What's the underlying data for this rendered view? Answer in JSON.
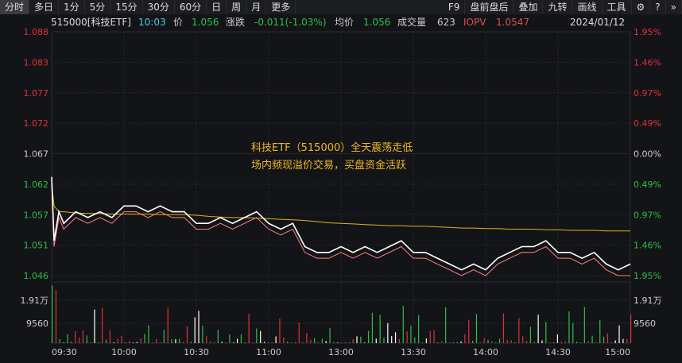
{
  "tabs": [
    "分时",
    "多日",
    "1分",
    "5分",
    "15分",
    "30分",
    "60分",
    "日",
    "周",
    "月",
    "更多"
  ],
  "right_tabs": [
    "F9",
    "盘前盘后",
    "叠加",
    "九转",
    "画线",
    "工具"
  ],
  "info": {
    "code": "515000[科技ETF]",
    "time": "10:03",
    "price_label": "价",
    "price": "1.056",
    "change_label": "涨跌",
    "change": "-0.011(-1.03%)",
    "avg_label": "均价",
    "avg": "1.056",
    "vol_label": "成交量",
    "vol": "623",
    "iopv_label": "IOPV",
    "iopv": "1.0547",
    "date": "2024/01/12"
  },
  "annotation": [
    "科技ETF（515000）全天震荡走低",
    "场内频现溢价交易，买盘资金活跃"
  ],
  "colors": {
    "up": "#e0303a",
    "down": "#2fbf4a",
    "price": "#ffffff",
    "iopv": "#ff8080",
    "avg": "#e0b020"
  },
  "chart_data": {
    "type": "line",
    "ylim": [
      1.046,
      1.088
    ],
    "prev_close": 1.067,
    "yticks_left": [
      "1.088",
      "1.083",
      "1.077",
      "1.072",
      "1.067",
      "1.062",
      "1.057",
      "1.051",
      "1.046"
    ],
    "yticks_right": [
      "1.95%",
      "1.46%",
      "0.97%",
      "0.49%",
      "0.00%",
      "0.49%",
      "0.97%",
      "1.46%",
      "1.95%"
    ],
    "xticks": [
      "09:30",
      "10:00",
      "10:30",
      "11:00",
      "13:00",
      "13:30",
      "14:00",
      "14:30",
      "15:00"
    ],
    "vol_ticks": [
      "1.91万",
      "9560"
    ],
    "vol_max": 28000,
    "minutes": [
      0,
      1,
      3,
      5,
      10,
      15,
      20,
      25,
      30,
      35,
      40,
      45,
      50,
      55,
      60,
      65,
      70,
      75,
      80,
      85,
      90,
      95,
      100,
      105,
      110,
      115,
      120,
      125,
      130,
      135,
      140,
      145,
      150,
      155,
      160,
      165,
      170,
      175,
      180,
      185,
      190,
      195,
      200,
      205,
      210,
      215,
      220,
      225,
      230,
      235,
      240
    ],
    "series": [
      {
        "name": "价格",
        "values": [
          1.063,
          1.052,
          1.057,
          1.055,
          1.057,
          1.056,
          1.057,
          1.056,
          1.058,
          1.058,
          1.057,
          1.058,
          1.057,
          1.057,
          1.055,
          1.055,
          1.056,
          1.055,
          1.056,
          1.057,
          1.055,
          1.054,
          1.055,
          1.051,
          1.05,
          1.05,
          1.051,
          1.05,
          1.051,
          1.05,
          1.051,
          1.052,
          1.05,
          1.05,
          1.049,
          1.048,
          1.047,
          1.048,
          1.047,
          1.049,
          1.05,
          1.051,
          1.051,
          1.052,
          1.05,
          1.05,
          1.049,
          1.05,
          1.048,
          1.047,
          1.048
        ]
      },
      {
        "name": "IOPV",
        "values": [
          1.062,
          1.051,
          1.056,
          1.054,
          1.056,
          1.055,
          1.056,
          1.055,
          1.057,
          1.057,
          1.056,
          1.057,
          1.056,
          1.056,
          1.054,
          1.054,
          1.055,
          1.054,
          1.055,
          1.056,
          1.054,
          1.053,
          1.054,
          1.05,
          1.049,
          1.049,
          1.05,
          1.049,
          1.05,
          1.049,
          1.05,
          1.051,
          1.049,
          1.049,
          1.048,
          1.047,
          1.046,
          1.047,
          1.046,
          1.048,
          1.049,
          1.05,
          1.05,
          1.051,
          1.049,
          1.049,
          1.048,
          1.049,
          1.047,
          1.046,
          1.046
        ]
      },
      {
        "name": "均价",
        "values": [
          1.062,
          1.058,
          1.057,
          1.057,
          1.0568,
          1.0567,
          1.0567,
          1.0566,
          1.0566,
          1.0566,
          1.0566,
          1.0565,
          1.0565,
          1.0565,
          1.0564,
          1.0562,
          1.0561,
          1.056,
          1.056,
          1.0559,
          1.0558,
          1.0557,
          1.0556,
          1.0555,
          1.0553,
          1.0551,
          1.055,
          1.0549,
          1.0548,
          1.0547,
          1.0546,
          1.0546,
          1.0545,
          1.0545,
          1.0544,
          1.0543,
          1.0542,
          1.0542,
          1.0541,
          1.0541,
          1.054,
          1.054,
          1.054,
          1.0539,
          1.0539,
          1.0538,
          1.0538,
          1.0538,
          1.0537,
          1.0537,
          1.0537
        ]
      }
    ]
  }
}
